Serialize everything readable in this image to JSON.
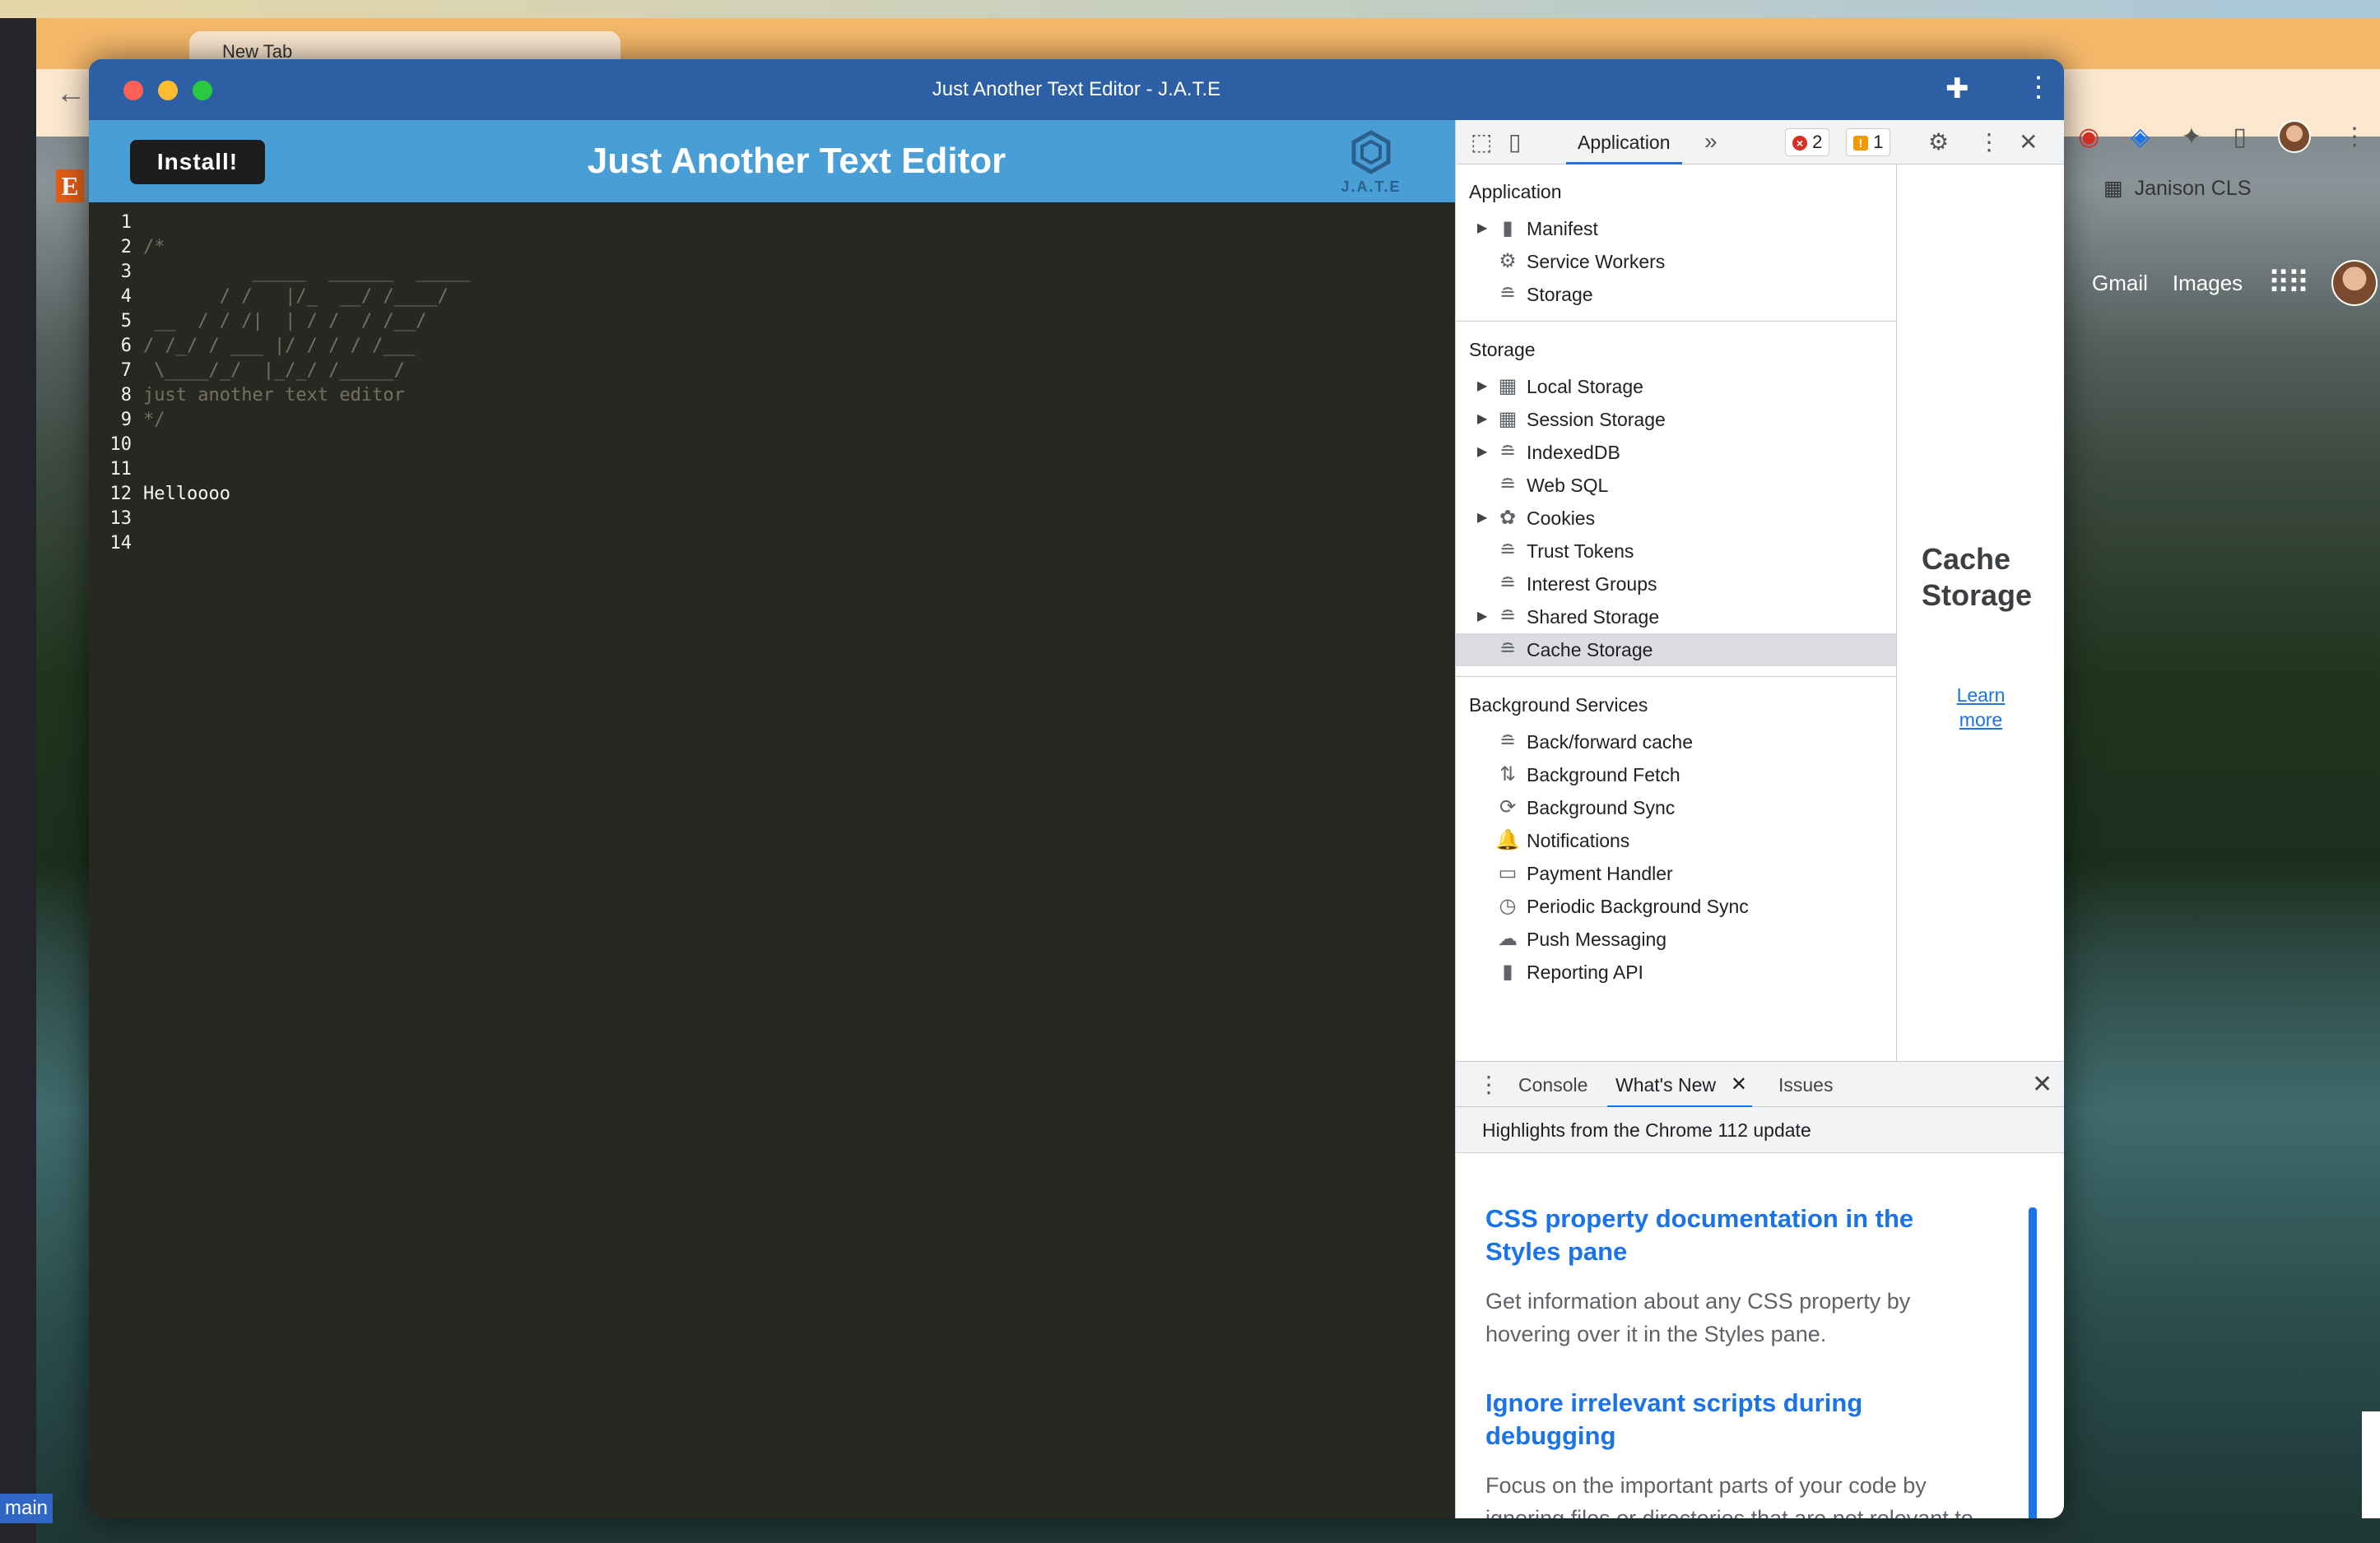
{
  "browser": {
    "tab_title": "New Tab",
    "bookmark": "Janison CLS",
    "bookmark_more": "»",
    "google_links": [
      "Gmail",
      "Images"
    ],
    "bottom_label": "main"
  },
  "window": {
    "title": "Just Another Text Editor - J.A.T.E",
    "traffic_colors": [
      "#fe5f57",
      "#febc2e",
      "#28c840"
    ]
  },
  "app": {
    "install_label": "Install!",
    "heading": "Just Another Text Editor",
    "logo_text": "J.A.T.E"
  },
  "editor": {
    "lines": [
      {
        "num": "1",
        "text": "",
        "style": "comment"
      },
      {
        "num": "2",
        "text": "/*",
        "style": "comment"
      },
      {
        "num": "3",
        "text": "          _____  ______  _____",
        "style": "comment"
      },
      {
        "num": "4",
        "text": "       / /   |/_  __/ /____/",
        "style": "comment"
      },
      {
        "num": "5",
        "text": " __  / / /|  | / /  / /__/",
        "style": "comment"
      },
      {
        "num": "6",
        "text": "/ /_/ / ___ |/ / / / /___",
        "style": "comment"
      },
      {
        "num": "7",
        "text": " \\____/_/  |_/_/ /_____/",
        "style": "comment"
      },
      {
        "num": "8",
        "text": "just another text editor",
        "style": "comment"
      },
      {
        "num": "9",
        "text": "*/",
        "style": "comment"
      },
      {
        "num": "10",
        "text": "",
        "style": "comment"
      },
      {
        "num": "11",
        "text": "",
        "style": "comment"
      },
      {
        "num": "12",
        "text": "Helloooo",
        "style": "plain"
      },
      {
        "num": "13",
        "text": "",
        "style": "plain"
      },
      {
        "num": "14",
        "text": "",
        "style": "plain"
      }
    ]
  },
  "devtools": {
    "active_tab": "Application",
    "more_tabs": "»",
    "errors": "2",
    "warnings": "1",
    "sections": [
      {
        "heading": "Application",
        "items": [
          {
            "label": "Manifest",
            "icon": "file-icon",
            "expandable": true
          },
          {
            "label": "Service Workers",
            "icon": "gear-icon",
            "expandable": false
          },
          {
            "label": "Storage",
            "icon": "database-icon",
            "expandable": false
          }
        ]
      },
      {
        "heading": "Storage",
        "items": [
          {
            "label": "Local Storage",
            "icon": "grid-icon",
            "expandable": true
          },
          {
            "label": "Session Storage",
            "icon": "grid-icon",
            "expandable": true
          },
          {
            "label": "IndexedDB",
            "icon": "database-icon",
            "expandable": true
          },
          {
            "label": "Web SQL",
            "icon": "database-icon",
            "expandable": false
          },
          {
            "label": "Cookies",
            "icon": "cookie-icon",
            "expandable": true
          },
          {
            "label": "Trust Tokens",
            "icon": "database-icon",
            "expandable": false
          },
          {
            "label": "Interest Groups",
            "icon": "database-icon",
            "expandable": false
          },
          {
            "label": "Shared Storage",
            "icon": "database-icon",
            "expandable": true
          },
          {
            "label": "Cache Storage",
            "icon": "database-icon",
            "expandable": false,
            "selected": true
          }
        ]
      },
      {
        "heading": "Background Services",
        "items": [
          {
            "label": "Back/forward cache",
            "icon": "database-icon",
            "expandable": false
          },
          {
            "label": "Background Fetch",
            "icon": "arrows-updown-icon",
            "expandable": false
          },
          {
            "label": "Background Sync",
            "icon": "sync-icon",
            "expandable": false
          },
          {
            "label": "Notifications",
            "icon": "bell-icon",
            "expandable": false
          },
          {
            "label": "Payment Handler",
            "icon": "card-icon",
            "expandable": false
          },
          {
            "label": "Periodic Background Sync",
            "icon": "clock-icon",
            "expandable": false
          },
          {
            "label": "Push Messaging",
            "icon": "cloud-icon",
            "expandable": false
          },
          {
            "label": "Reporting API",
            "icon": "file-icon",
            "expandable": false
          }
        ]
      }
    ],
    "main": {
      "title": "Cache Storage",
      "learn_more": "Learn more"
    },
    "drawer": {
      "tabs": [
        "Console",
        "What's New",
        "Issues"
      ],
      "active": "What's New",
      "highlight": "Highlights from the Chrome 112 update",
      "entries": [
        {
          "title": "CSS property documentation in the Styles pane",
          "desc": "Get information about any CSS property by hovering over it in the Styles pane."
        },
        {
          "title": "Ignore irrelevant scripts during debugging",
          "desc": "Focus on the important parts of your code by ignoring files or directories that are not relevant to the issue at hand."
        }
      ]
    }
  }
}
